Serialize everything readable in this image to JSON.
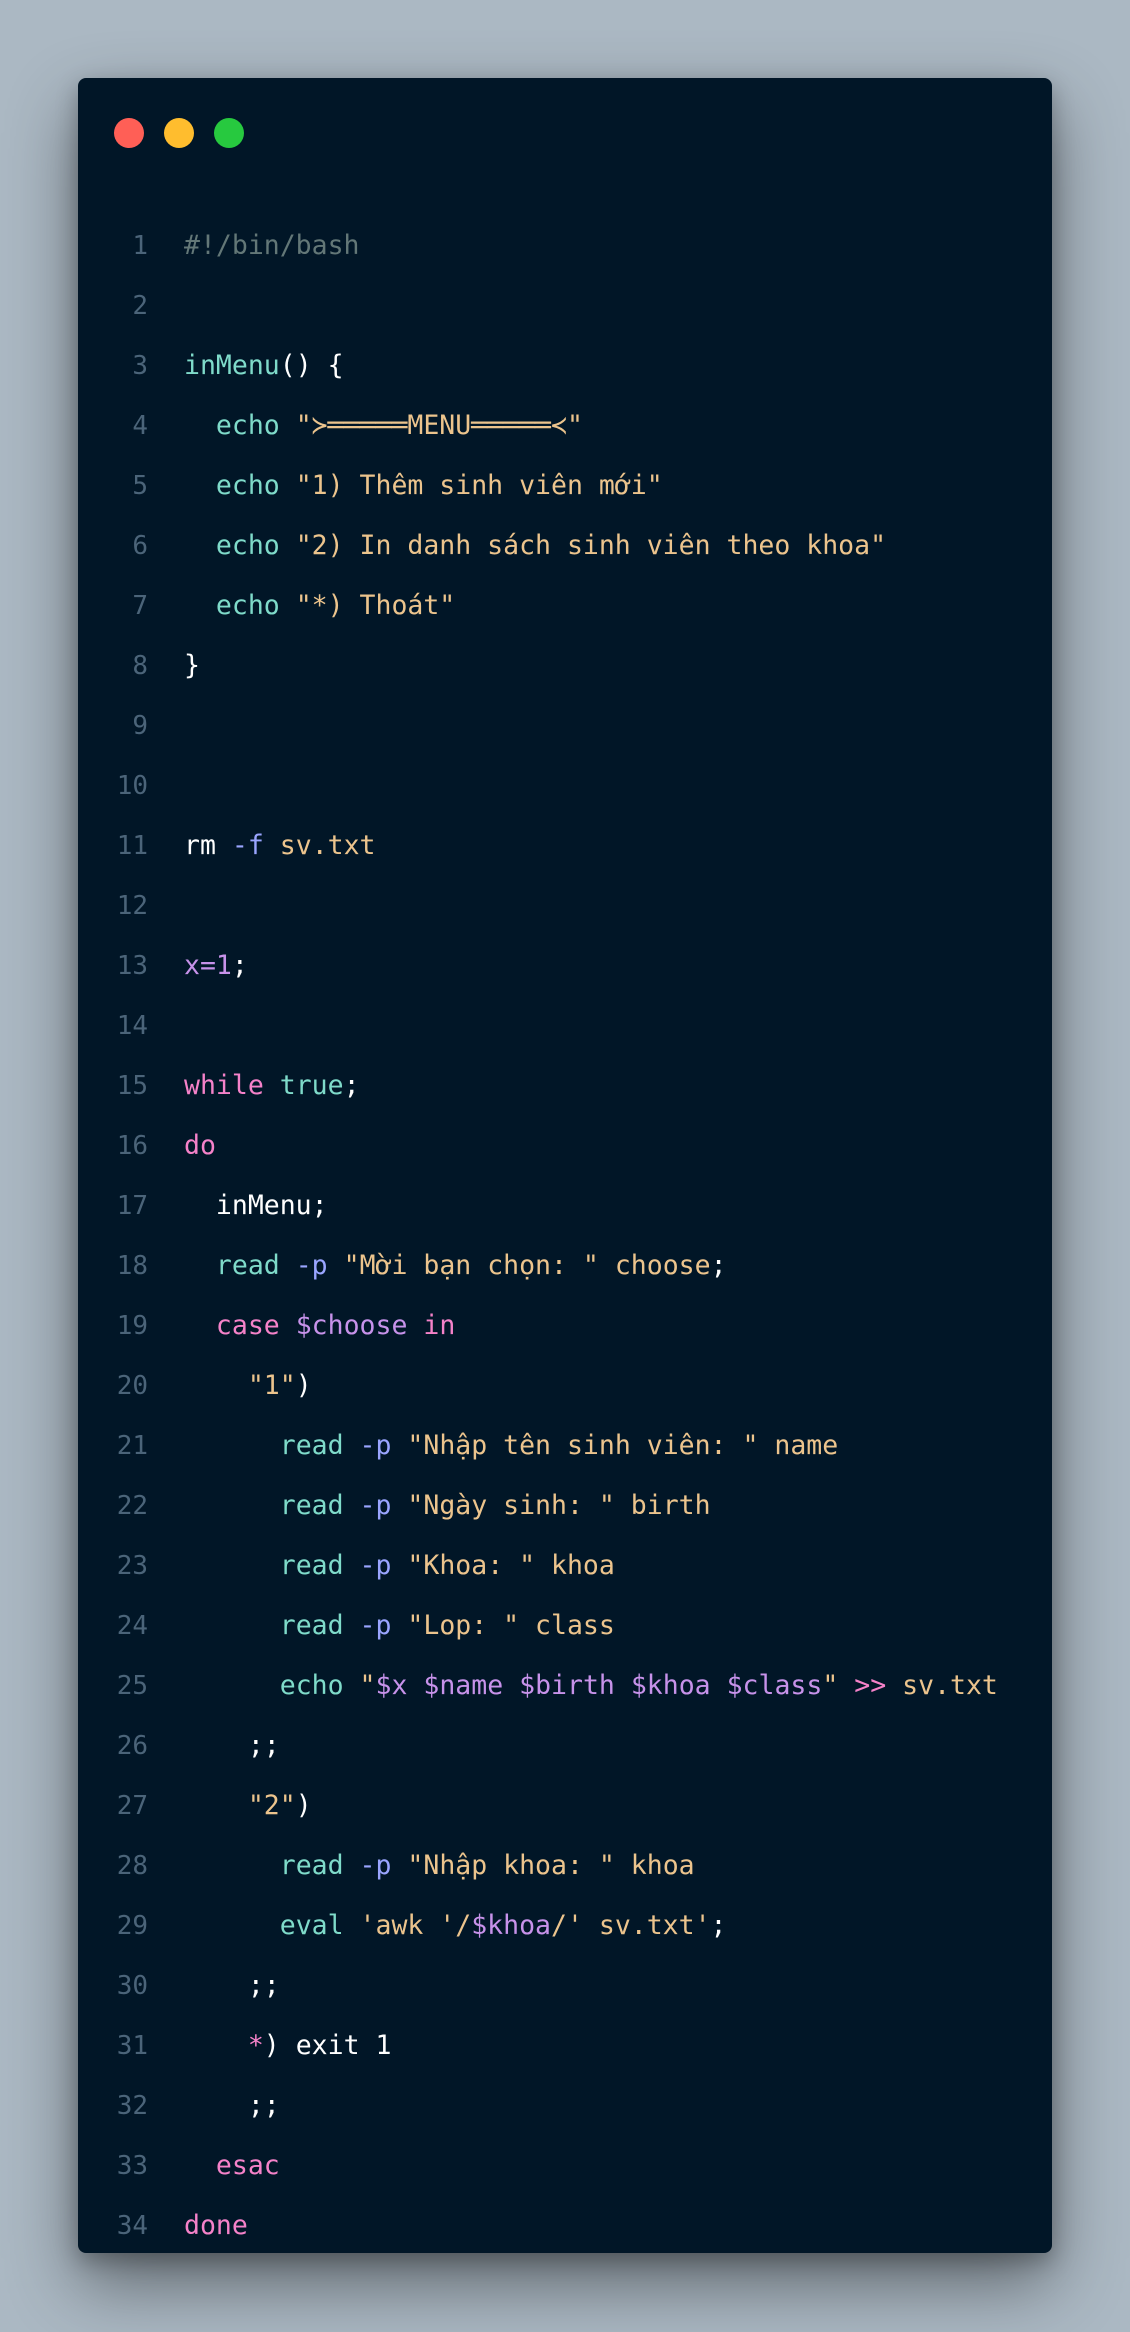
{
  "window": {
    "controls": [
      "close",
      "minimize",
      "zoom"
    ],
    "colors": {
      "background": "#011627",
      "page": "#abb8c3",
      "close": "#ff5f56",
      "minimize": "#ffbd2e",
      "zoom": "#27c93f"
    }
  },
  "lines": [
    {
      "n": "1",
      "tokens": [
        {
          "t": "#!/bin/bash",
          "c": "comment"
        }
      ]
    },
    {
      "n": "2",
      "tokens": []
    },
    {
      "n": "3",
      "tokens": [
        {
          "t": "inMenu",
          "c": "fn"
        },
        {
          "t": "() {",
          "c": "plain"
        }
      ]
    },
    {
      "n": "4",
      "tokens": [
        {
          "t": "  ",
          "c": "plain"
        },
        {
          "t": "echo",
          "c": "cmd"
        },
        {
          "t": " ",
          "c": "plain"
        },
        {
          "t": "\"≻═════MENU═════≺\"",
          "c": "str"
        }
      ]
    },
    {
      "n": "5",
      "tokens": [
        {
          "t": "  ",
          "c": "plain"
        },
        {
          "t": "echo",
          "c": "cmd"
        },
        {
          "t": " ",
          "c": "plain"
        },
        {
          "t": "\"1) Thêm sinh viên mới\"",
          "c": "str"
        }
      ]
    },
    {
      "n": "6",
      "tokens": [
        {
          "t": "  ",
          "c": "plain"
        },
        {
          "t": "echo",
          "c": "cmd"
        },
        {
          "t": " ",
          "c": "plain"
        },
        {
          "t": "\"2) In danh sách sinh viên theo khoa\"",
          "c": "str"
        }
      ]
    },
    {
      "n": "7",
      "tokens": [
        {
          "t": "  ",
          "c": "plain"
        },
        {
          "t": "echo",
          "c": "cmd"
        },
        {
          "t": " ",
          "c": "plain"
        },
        {
          "t": "\"*) Thoát\"",
          "c": "str"
        }
      ]
    },
    {
      "n": "8",
      "tokens": [
        {
          "t": "}",
          "c": "plain"
        }
      ]
    },
    {
      "n": "9",
      "tokens": []
    },
    {
      "n": "10",
      "tokens": []
    },
    {
      "n": "11",
      "tokens": [
        {
          "t": "rm",
          "c": "plain"
        },
        {
          "t": " ",
          "c": "plain"
        },
        {
          "t": "-f",
          "c": "flag"
        },
        {
          "t": " ",
          "c": "plain"
        },
        {
          "t": "sv.txt",
          "c": "str"
        }
      ]
    },
    {
      "n": "12",
      "tokens": []
    },
    {
      "n": "13",
      "tokens": [
        {
          "t": "x=",
          "c": "var"
        },
        {
          "t": "1",
          "c": "num"
        },
        {
          "t": ";",
          "c": "plain"
        }
      ]
    },
    {
      "n": "14",
      "tokens": []
    },
    {
      "n": "15",
      "tokens": [
        {
          "t": "while",
          "c": "kw"
        },
        {
          "t": " ",
          "c": "plain"
        },
        {
          "t": "true",
          "c": "cmd"
        },
        {
          "t": ";",
          "c": "plain"
        }
      ]
    },
    {
      "n": "16",
      "tokens": [
        {
          "t": "do",
          "c": "kw"
        }
      ]
    },
    {
      "n": "17",
      "tokens": [
        {
          "t": "  inMenu;",
          "c": "plain"
        }
      ]
    },
    {
      "n": "18",
      "tokens": [
        {
          "t": "  ",
          "c": "plain"
        },
        {
          "t": "read",
          "c": "cmd"
        },
        {
          "t": " ",
          "c": "plain"
        },
        {
          "t": "-p",
          "c": "flag"
        },
        {
          "t": " ",
          "c": "plain"
        },
        {
          "t": "\"Mời bạn chọn: \" choose",
          "c": "str"
        },
        {
          "t": ";",
          "c": "plain"
        }
      ]
    },
    {
      "n": "19",
      "tokens": [
        {
          "t": "  ",
          "c": "plain"
        },
        {
          "t": "case",
          "c": "kw"
        },
        {
          "t": " ",
          "c": "plain"
        },
        {
          "t": "$choose",
          "c": "var"
        },
        {
          "t": " ",
          "c": "plain"
        },
        {
          "t": "in",
          "c": "kw"
        }
      ]
    },
    {
      "n": "20",
      "tokens": [
        {
          "t": "    ",
          "c": "plain"
        },
        {
          "t": "\"1\"",
          "c": "str"
        },
        {
          "t": ")",
          "c": "plain"
        }
      ]
    },
    {
      "n": "21",
      "tokens": [
        {
          "t": "      ",
          "c": "plain"
        },
        {
          "t": "read",
          "c": "cmd"
        },
        {
          "t": " ",
          "c": "plain"
        },
        {
          "t": "-p",
          "c": "flag"
        },
        {
          "t": " ",
          "c": "plain"
        },
        {
          "t": "\"Nhập tên sinh viên: \" name",
          "c": "str"
        }
      ]
    },
    {
      "n": "22",
      "tokens": [
        {
          "t": "      ",
          "c": "plain"
        },
        {
          "t": "read",
          "c": "cmd"
        },
        {
          "t": " ",
          "c": "plain"
        },
        {
          "t": "-p",
          "c": "flag"
        },
        {
          "t": " ",
          "c": "plain"
        },
        {
          "t": "\"Ngày sinh: \" birth",
          "c": "str"
        }
      ]
    },
    {
      "n": "23",
      "tokens": [
        {
          "t": "      ",
          "c": "plain"
        },
        {
          "t": "read",
          "c": "cmd"
        },
        {
          "t": " ",
          "c": "plain"
        },
        {
          "t": "-p",
          "c": "flag"
        },
        {
          "t": " ",
          "c": "plain"
        },
        {
          "t": "\"Khoa: \" khoa",
          "c": "str"
        }
      ]
    },
    {
      "n": "24",
      "tokens": [
        {
          "t": "      ",
          "c": "plain"
        },
        {
          "t": "read",
          "c": "cmd"
        },
        {
          "t": " ",
          "c": "plain"
        },
        {
          "t": "-p",
          "c": "flag"
        },
        {
          "t": " ",
          "c": "plain"
        },
        {
          "t": "\"Lop: \" class",
          "c": "str"
        }
      ]
    },
    {
      "n": "25",
      "tokens": [
        {
          "t": "      ",
          "c": "plain"
        },
        {
          "t": "echo",
          "c": "cmd"
        },
        {
          "t": " ",
          "c": "plain"
        },
        {
          "t": "\"",
          "c": "str"
        },
        {
          "t": "$x",
          "c": "var"
        },
        {
          "t": " ",
          "c": "str"
        },
        {
          "t": "$name",
          "c": "var"
        },
        {
          "t": " ",
          "c": "str"
        },
        {
          "t": "$birth",
          "c": "var"
        },
        {
          "t": " ",
          "c": "str"
        },
        {
          "t": "$khoa",
          "c": "var"
        },
        {
          "t": " ",
          "c": "str"
        },
        {
          "t": "$class",
          "c": "var"
        },
        {
          "t": "\"",
          "c": "str"
        },
        {
          "t": " ",
          "c": "plain"
        },
        {
          "t": ">>",
          "c": "op"
        },
        {
          "t": " ",
          "c": "plain"
        },
        {
          "t": "sv.txt",
          "c": "str"
        }
      ]
    },
    {
      "n": "26",
      "tokens": [
        {
          "t": "    ;;",
          "c": "plain"
        }
      ]
    },
    {
      "n": "27",
      "tokens": [
        {
          "t": "    ",
          "c": "plain"
        },
        {
          "t": "\"2\"",
          "c": "str"
        },
        {
          "t": ")",
          "c": "plain"
        }
      ]
    },
    {
      "n": "28",
      "tokens": [
        {
          "t": "      ",
          "c": "plain"
        },
        {
          "t": "read",
          "c": "cmd"
        },
        {
          "t": " ",
          "c": "plain"
        },
        {
          "t": "-p",
          "c": "flag"
        },
        {
          "t": " ",
          "c": "plain"
        },
        {
          "t": "\"Nhập khoa: \" khoa",
          "c": "str"
        }
      ]
    },
    {
      "n": "29",
      "tokens": [
        {
          "t": "      ",
          "c": "plain"
        },
        {
          "t": "eval",
          "c": "cmd"
        },
        {
          "t": " ",
          "c": "plain"
        },
        {
          "t": "'awk '/",
          "c": "str"
        },
        {
          "t": "$khoa",
          "c": "var"
        },
        {
          "t": "/' sv.txt'",
          "c": "str"
        },
        {
          "t": ";",
          "c": "plain"
        }
      ]
    },
    {
      "n": "30",
      "tokens": [
        {
          "t": "    ;;",
          "c": "plain"
        }
      ]
    },
    {
      "n": "31",
      "tokens": [
        {
          "t": "    ",
          "c": "plain"
        },
        {
          "t": "*",
          "c": "op"
        },
        {
          "t": ") exit 1",
          "c": "plain"
        }
      ]
    },
    {
      "n": "32",
      "tokens": [
        {
          "t": "    ;;",
          "c": "plain"
        }
      ]
    },
    {
      "n": "33",
      "tokens": [
        {
          "t": "  ",
          "c": "plain"
        },
        {
          "t": "esac",
          "c": "kw"
        }
      ]
    },
    {
      "n": "34",
      "tokens": [
        {
          "t": "done",
          "c": "kw"
        }
      ]
    }
  ]
}
